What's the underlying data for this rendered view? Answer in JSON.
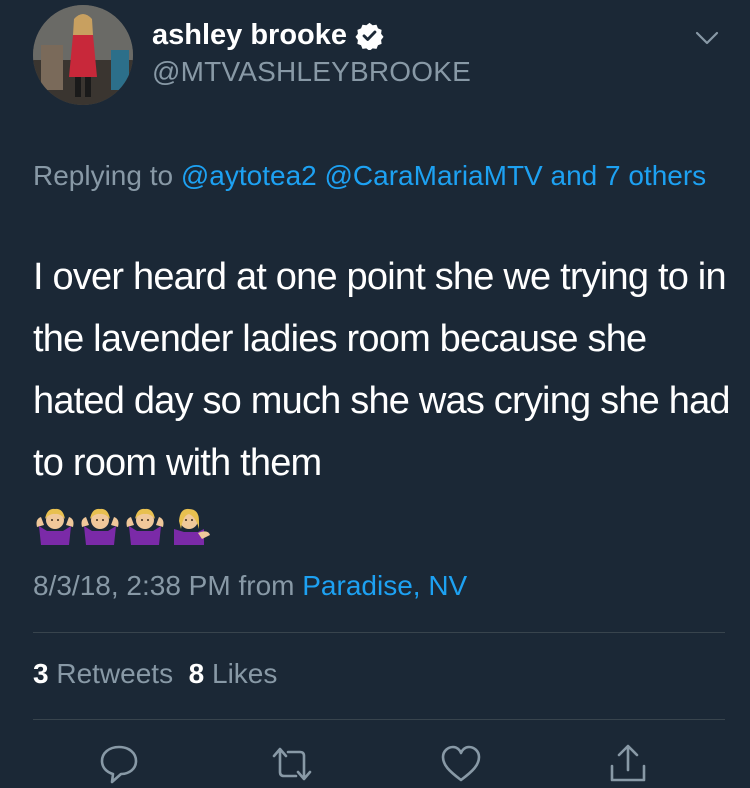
{
  "user": {
    "display_name": "ashley brooke",
    "handle": "@MTVASHLEYBROOKE",
    "verified": true,
    "avatar_icon": "avatar-photo"
  },
  "reply": {
    "prefix": "Replying to ",
    "mention1": "@aytotea2",
    "mention2": "@CaraMariaMTV",
    "others": "and 7 others"
  },
  "tweet": {
    "text": "I over heard at one point she we trying to in the lavender ladies room because she hated day so much she was crying she had to room with them",
    "emojis": [
      "person-shrugging-emoji",
      "person-shrugging-emoji",
      "person-shrugging-emoji",
      "person-tipping-hand-emoji"
    ]
  },
  "meta": {
    "timestamp": "8/3/18, 2:38 PM",
    "from_label": "from",
    "location": "Paradise, NV"
  },
  "stats": {
    "retweets_count": "3",
    "retweets_label": "Retweets",
    "likes_count": "8",
    "likes_label": "Likes"
  },
  "actions": [
    "reply-icon",
    "retweet-icon",
    "like-icon",
    "share-icon"
  ],
  "colors": {
    "background": "#1b2836",
    "link": "#1da1f2",
    "secondary_text": "#8899a6",
    "divider": "#38444d"
  }
}
